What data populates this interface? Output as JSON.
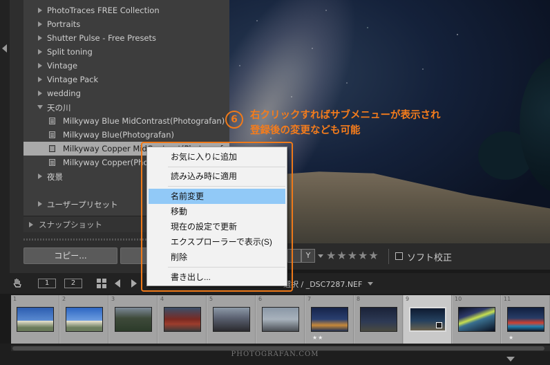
{
  "preset_panel": {
    "items": [
      {
        "label": "PhotoTraces FREE Collection",
        "type": "folder",
        "expanded": false
      },
      {
        "label": "Portraits",
        "type": "folder",
        "expanded": false
      },
      {
        "label": "Shutter Pulse - Free Presets",
        "type": "folder",
        "expanded": false
      },
      {
        "label": "Split toning",
        "type": "folder",
        "expanded": false
      },
      {
        "label": "Vintage",
        "type": "folder",
        "expanded": false
      },
      {
        "label": "Vintage Pack",
        "type": "folder",
        "expanded": false
      },
      {
        "label": "wedding",
        "type": "folder",
        "expanded": false
      },
      {
        "label": "天の川",
        "type": "folder",
        "expanded": true
      },
      {
        "label": "Milkyway Blue MidContrast(Photografan)",
        "type": "preset"
      },
      {
        "label": "Milkyway Blue(Photografan)",
        "type": "preset"
      },
      {
        "label": "Milkyway Copper MidContrast(Photografan)",
        "type": "preset",
        "selected": true
      },
      {
        "label": "Milkyway Copper(Photografan)",
        "type": "preset"
      },
      {
        "label": "夜景",
        "type": "folder",
        "expanded": false
      },
      {
        "label": "ユーザープリセット",
        "type": "folder",
        "expanded": false
      }
    ],
    "snapshot_label": "スナップショット",
    "copy_button": "コピー..."
  },
  "annotation": {
    "number": "6",
    "line1": "右クリックすればサブメニューが表示され",
    "line2": "登録後の変更なども可能",
    "color": "#f07a1a"
  },
  "context_menu": {
    "items": [
      {
        "label": "お気に入りに追加"
      },
      {
        "label": "読み込み時に適用"
      },
      {
        "label": "名前変更",
        "highlighted": true
      },
      {
        "label": "移動"
      },
      {
        "label": "現在の設定で更新"
      },
      {
        "label": "エクスプローラーで表示(S)"
      },
      {
        "label": "削除"
      },
      {
        "label": "書き出し..."
      }
    ]
  },
  "photo_toolbar": {
    "xy_label": "Y",
    "rating_stars": "★★★★★",
    "soft_proof_label": "ソフト校正"
  },
  "film_bar": {
    "view1": "1",
    "view2": "2",
    "file_info": "選択 / _DSC7287.NEF"
  },
  "filmstrip": {
    "thumbs": [
      {
        "num": "1",
        "rating": ""
      },
      {
        "num": "2",
        "rating": ""
      },
      {
        "num": "3",
        "rating": ""
      },
      {
        "num": "4",
        "rating": ""
      },
      {
        "num": "5",
        "rating": ""
      },
      {
        "num": "6",
        "rating": ""
      },
      {
        "num": "7",
        "rating": "★★"
      },
      {
        "num": "8",
        "rating": ""
      },
      {
        "num": "9",
        "rating": "",
        "active": true
      },
      {
        "num": "10",
        "rating": ""
      },
      {
        "num": "11",
        "rating": "★"
      }
    ]
  },
  "watermark": "PHOTOGRAFAN.COM"
}
